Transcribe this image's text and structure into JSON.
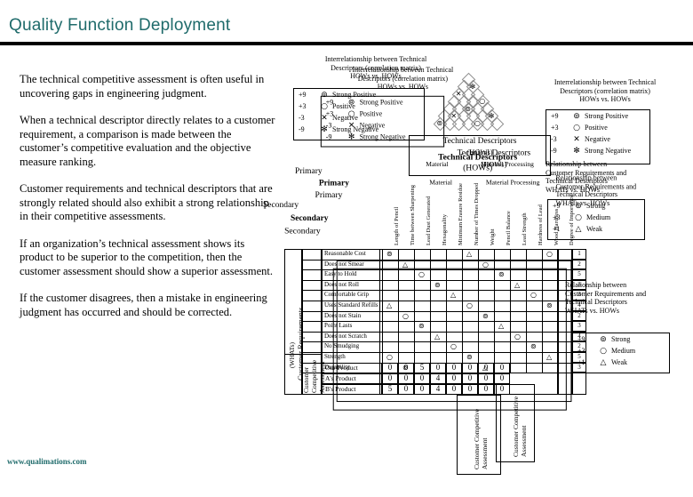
{
  "slide": {
    "title": "Quality Function Deployment",
    "footer_link": "www.qualimations.com",
    "title_color": "#1f6b6b",
    "rule_color": "#000000"
  },
  "body_paragraphs": [
    "The technical competitive assessment is often useful in uncovering gaps in engineering judgment.",
    "When a technical descriptor directly relates to a customer requirement, a comparison is made between the customer’s competitive evaluation and the objective measure ranking.",
    "Customer requirements and technical descriptors that are strongly related should also exhibit a strong relationship in their competitive assessments.",
    "If an organization’s technical assessment shows its product to be superior to the competition, then the customer assessment should show a superior assessment.",
    "If the customer disagrees, then a mistake in engineering judgment has occurred and should be corrected."
  ],
  "qfd": {
    "roof_caption": {
      "line1": "Interrelationship between Technical",
      "line2": "Descriptors (correlation matrix)",
      "line3": "HOWs vs. HOWs"
    },
    "roof_legend": [
      {
        "score": "+9",
        "glyph": "⊚",
        "label": "Strong Positive"
      },
      {
        "score": "+3",
        "glyph": "○",
        "label": "Positive"
      },
      {
        "score": "-3",
        "glyph": "✕",
        "label": "Negative"
      },
      {
        "score": "-9",
        "glyph": "✻",
        "label": "Strong Negative"
      }
    ],
    "relationship_caption": {
      "line1": "Relationship between",
      "line2": "Customer Requirements and",
      "line3": "Technical Descriptors",
      "line4": "WHATs vs. HOWs"
    },
    "relationship_legend": [
      {
        "score": "+9",
        "glyph": "⊚",
        "label": "Strong"
      },
      {
        "score": "+3",
        "glyph": "○",
        "label": "Medium"
      },
      {
        "score": "+1",
        "glyph": "△",
        "label": "Weak"
      }
    ],
    "headers": {
      "technical_descriptors": "Technical Descriptors",
      "technical_descriptors_sub": "(HOWs)",
      "primary": "Primary",
      "secondary": "Secondary",
      "material": "Material",
      "material_processing": "Material Processing",
      "customer_requirements": "Customer Requirements",
      "customer_requirements_sub": "(WHATs)",
      "customer_competitive_assessment": "Customer Competitive Assessment",
      "degree_of_importance": "Degree of Importance",
      "our_product": "Our Product",
      "a_product": "A's Product",
      "b_product": "B's Product"
    },
    "customer_requirement_rows": [
      "Reasonable Cost",
      "Does not Smear",
      "Easy to Hold",
      "Does not Roll",
      "Comfortable Grip",
      "Uses Standard Refills",
      "Does not Stain",
      "Point Lasts",
      "Does not Scratch",
      "No Smudging",
      "Strength",
      "Durability"
    ],
    "technical_columns": [
      "Length of Pencil",
      "Time between Sharpening",
      "Lead Dust Generated",
      "Hexagonality",
      "Minimum Erasure Residue",
      "Number of Times Dropped",
      "Weight",
      "Pencil Balance",
      "Lead Strength",
      "Hardness of Lead",
      "Wood Hardness"
    ],
    "bottom_rows": [
      {
        "label": "Our Product",
        "values": [
          "0",
          "0",
          "5",
          "0",
          "0",
          "0",
          "0",
          "0"
        ]
      },
      {
        "label": "A's Product",
        "values": [
          "0",
          "0",
          "0",
          "4",
          "0",
          "0",
          "0",
          "0"
        ]
      },
      {
        "label": "B's Product",
        "values": [
          "5",
          "0",
          "0",
          "4",
          "0",
          "0",
          "0",
          "0"
        ]
      }
    ],
    "importance_values": [
      "1",
      "2",
      "5",
      "3",
      "3",
      "4",
      "2",
      "3",
      "4",
      "2",
      "5",
      "3"
    ]
  }
}
